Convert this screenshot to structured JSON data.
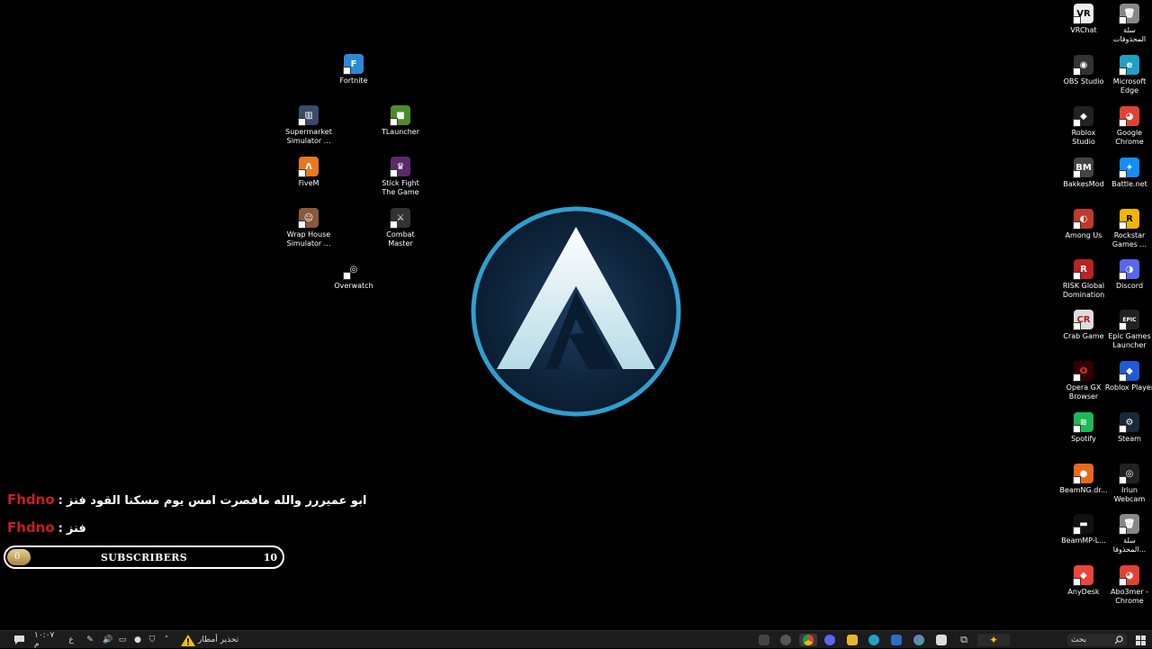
{
  "desktop_icons_left": [
    {
      "id": "fortnite",
      "label": "Fortnite",
      "color": "#2b8ad6",
      "glyph": "F"
    },
    {
      "id": "supermarket",
      "label": "Supermarket\nSimulator ...",
      "color": "#3a4a6a",
      "glyph": "▥"
    },
    {
      "id": "tlauncher",
      "label": "TLauncher",
      "color": "#4c8c2c",
      "glyph": "■"
    },
    {
      "id": "fivem",
      "label": "FiveM",
      "color": "#e87822",
      "glyph": "Λ"
    },
    {
      "id": "stickfight",
      "label": "Stick Fight\nThe Game",
      "color": "#5a2a6a",
      "glyph": "♛"
    },
    {
      "id": "wraphouse",
      "label": "Wrap House\nSimulator ...",
      "color": "#8a5a3a",
      "glyph": "☺"
    },
    {
      "id": "combatmaster",
      "label": "Combat\nMaster",
      "color": "#333",
      "glyph": "⚔"
    },
    {
      "id": "overwatch",
      "label": "Overwatch",
      "color": "#000",
      "glyph": "◎"
    }
  ],
  "desktop_icons_right": [
    {
      "id": "vrchat",
      "label": "VRChat",
      "color": "#eee",
      "glyph": "VR",
      "fg": "#000"
    },
    {
      "id": "recycle1",
      "label": "سلة\nالمحذوفات",
      "color": "#888",
      "glyph": "🗑"
    },
    {
      "id": "obs",
      "label": "OBS Studio",
      "color": "#333",
      "glyph": "◉"
    },
    {
      "id": "edge",
      "label": "Microsoft\nEdge",
      "color": "#1fa0c8",
      "glyph": "e"
    },
    {
      "id": "robloxstudio",
      "label": "Roblox\nStudio",
      "color": "#222",
      "glyph": "◆"
    },
    {
      "id": "chrome",
      "label": "Google\nChrome",
      "color": "#e34133",
      "glyph": "◕"
    },
    {
      "id": "bakkesmod",
      "label": "BakkesMod",
      "color": "#444",
      "glyph": "BM"
    },
    {
      "id": "battlenet",
      "label": "Battle.net",
      "color": "#148eff",
      "glyph": "✦"
    },
    {
      "id": "amongus",
      "label": "Among Us",
      "color": "#c0392b",
      "glyph": "◐"
    },
    {
      "id": "rockstar",
      "label": "Rockstar\nGames ...",
      "color": "#f4b400",
      "glyph": "R",
      "fg": "#000"
    },
    {
      "id": "risk",
      "label": "RISK Global\nDomination",
      "color": "#b22",
      "glyph": "R"
    },
    {
      "id": "discord",
      "label": "Discord",
      "color": "#5865f2",
      "glyph": "◑"
    },
    {
      "id": "crabgame",
      "label": "Crab Game",
      "color": "#ddd",
      "glyph": "CR",
      "fg": "#a22"
    },
    {
      "id": "epic",
      "label": "Epic Games\nLauncher",
      "color": "#222",
      "glyph": "EPIC"
    },
    {
      "id": "operagx",
      "label": "Opera GX\nBrowser",
      "color": "#300",
      "glyph": "O",
      "fg": "#e33"
    },
    {
      "id": "robloxplayer",
      "label": "Roblox Player",
      "color": "#1e5bd6",
      "glyph": "◆"
    },
    {
      "id": "spotify",
      "label": "Spotify",
      "color": "#1db954",
      "glyph": "≋"
    },
    {
      "id": "steam",
      "label": "Steam",
      "color": "#1b2838",
      "glyph": "⚙"
    },
    {
      "id": "beamng",
      "label": "BeamNG.dr...",
      "color": "#e86a1a",
      "glyph": "●"
    },
    {
      "id": "iriun",
      "label": "Iriun\nWebcam",
      "color": "#222",
      "glyph": "◎"
    },
    {
      "id": "beammp",
      "label": "BeamMP-L...",
      "color": "#111",
      "glyph": "▬"
    },
    {
      "id": "recycle2",
      "label": "سلة\nالمحذوفا...",
      "color": "#888",
      "glyph": "🗑"
    },
    {
      "id": "anydesk",
      "label": "AnyDesk",
      "color": "#ef443b",
      "glyph": "◆"
    },
    {
      "id": "abo3mer",
      "label": "Abo3mer -\nChrome",
      "color": "#e34133",
      "glyph": "◕"
    }
  ],
  "chat": [
    {
      "user": "Fhdno",
      "message": "ابو عميررر والله مافصرت امس يوم مسكنا القود فنز"
    },
    {
      "user": "Fhdno",
      "message": "فنز"
    }
  ],
  "subscribers": {
    "current": "0",
    "title": "SUBSCRIBERS",
    "goal": "10",
    "progress": 0
  },
  "taskbar": {
    "clock": "١٠:٠٧ م",
    "lang": "ع",
    "weather_label": "تحذير أمطار",
    "search_label": "بحث"
  }
}
